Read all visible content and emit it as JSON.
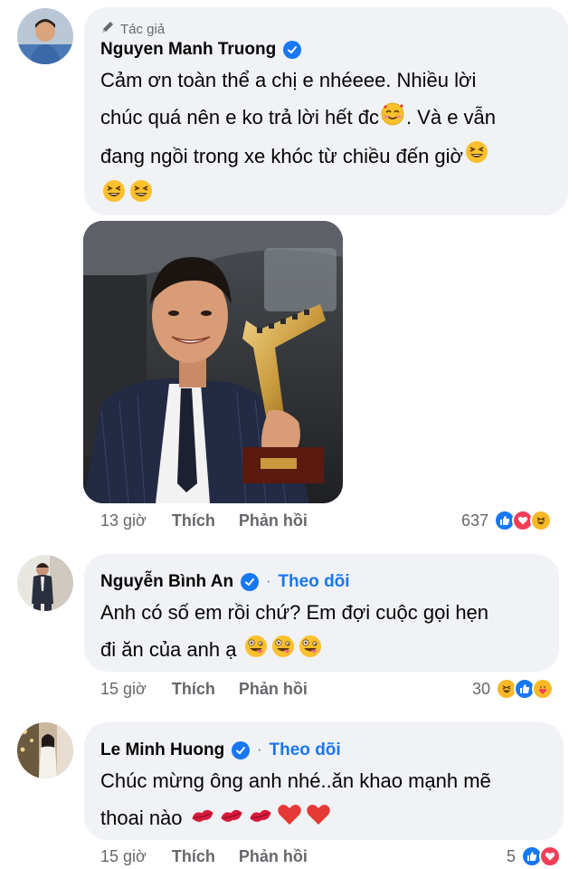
{
  "comments": [
    {
      "author_tag": "Tác giả",
      "name": "Nguyen Manh Truong",
      "lines": [
        "Cảm ơn toàn thể a chị e nhéeee. Nhiều lời",
        "chúc quá nên e ko trả lời hết đc",
        ". Và e vẫn",
        "đang ngồi trong xe khóc từ chiều đến giờ"
      ],
      "time": "13 giờ",
      "like_label": "Thích",
      "reply_label": "Phản hồi",
      "reaction_count": "637",
      "reactions": [
        "like",
        "love",
        "haha"
      ]
    },
    {
      "name": "Nguyễn Bình An",
      "dot": "·",
      "follow_label": "Theo dõi",
      "lines": [
        "Anh có số em rồi chứ? Em đợi cuộc gọi hẹn",
        "đi ăn của anh ạ"
      ],
      "time": "15 giờ",
      "like_label": "Thích",
      "reply_label": "Phản hồi",
      "reaction_count": "30",
      "reactions": [
        "haha",
        "like",
        "care"
      ]
    },
    {
      "name": "Le Minh Huong",
      "dot": "·",
      "follow_label": "Theo dõi",
      "lines": [
        "Chúc mừng ông anh nhé..ăn khao mạnh mẽ",
        "thoai nào"
      ],
      "time": "15 giờ",
      "like_label": "Thích",
      "reply_label": "Phản hồi",
      "reaction_count": "5",
      "reactions": [
        "like",
        "love"
      ]
    }
  ],
  "colors": {
    "bubble": "#f0f2f5",
    "verified": "#1877f2",
    "follow": "#1877f2",
    "meta": "#65676b",
    "like": "#1877f2",
    "love": "#f33e58",
    "haha": "#f7b928"
  },
  "icons": [
    "pen-icon",
    "verified-badge-icon",
    "grinning-squint-emoji",
    "smiling-hearts-emoji",
    "zany-face-emoji",
    "kiss-mark-emoji",
    "red-heart-emoji",
    "like-reaction-icon",
    "love-reaction-icon",
    "haha-reaction-icon",
    "care-reaction-icon"
  ]
}
